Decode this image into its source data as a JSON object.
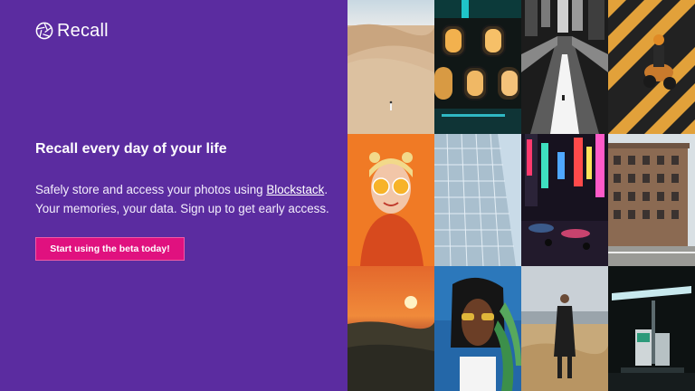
{
  "brand": {
    "name": "Recall",
    "logo_icon": "camera-shutter-icon"
  },
  "hero": {
    "headline": "Recall every day of your life",
    "text_before_link": "Safely store and access your photos using ",
    "link_label": "Blockstack",
    "text_after_link": ". Your memories, your data. Sign up to get early access.",
    "cta_label": "Start using the beta today!"
  },
  "colors": {
    "panel_background": "#5b2ca0",
    "cta_background": "#e0117f",
    "text": "#ffffff"
  },
  "photos": [
    {
      "subject": "person walking in desert dunes"
    },
    {
      "subject": "airplane windows at dusk"
    },
    {
      "subject": "empty highway bridge in city"
    },
    {
      "subject": "scooter rider on striped crosswalk"
    },
    {
      "subject": "woman holding orange slices over eyes"
    },
    {
      "subject": "glass skyscraper facade"
    },
    {
      "subject": "neon signs on night street"
    },
    {
      "subject": "brick apartment building"
    },
    {
      "subject": "sunset over forest"
    },
    {
      "subject": "woman with sunglasses and leaves"
    },
    {
      "subject": "man in coat on grassy hill"
    },
    {
      "subject": "gas pump at night"
    }
  ]
}
